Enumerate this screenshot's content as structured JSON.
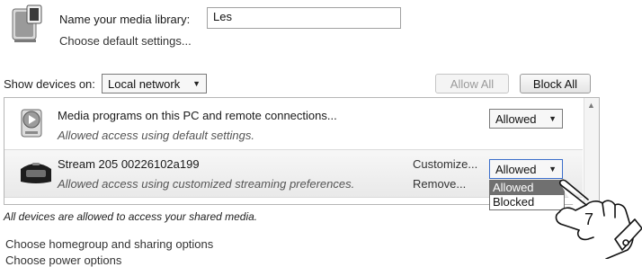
{
  "library": {
    "name_label": "Name your media library:",
    "name_value": "Les",
    "default_link": "Choose default settings..."
  },
  "devices": {
    "show_label": "Show devices on:",
    "network_value": "Local network",
    "allow_all": "Allow All",
    "block_all": "Block All",
    "items": [
      {
        "title": "Media programs on this PC and remote connections...",
        "subtitle": "Allowed access using default settings.",
        "status": "Allowed"
      },
      {
        "title": "Stream 205 00226102a199",
        "subtitle": "Allowed access using customized streaming preferences.",
        "customize": "Customize...",
        "remove": "Remove...",
        "status": "Allowed"
      }
    ],
    "dropdown_options": [
      "Allowed",
      "Blocked"
    ]
  },
  "footer": {
    "note": "All devices are allowed to access your shared media.",
    "links": [
      "Choose homegroup and sharing options",
      "Choose power options"
    ]
  },
  "annotation": {
    "step_number": "7"
  },
  "icons": {
    "media_library": "media-server-icon",
    "media_programs": "media-player-icon",
    "radio": "radio-icon",
    "hand": "pointing-hand-icon",
    "dropdown_arrow": "chevron-down-icon"
  },
  "colors": {
    "dropdown_highlight": "#707070",
    "focus_border": "#3b6ecb"
  }
}
